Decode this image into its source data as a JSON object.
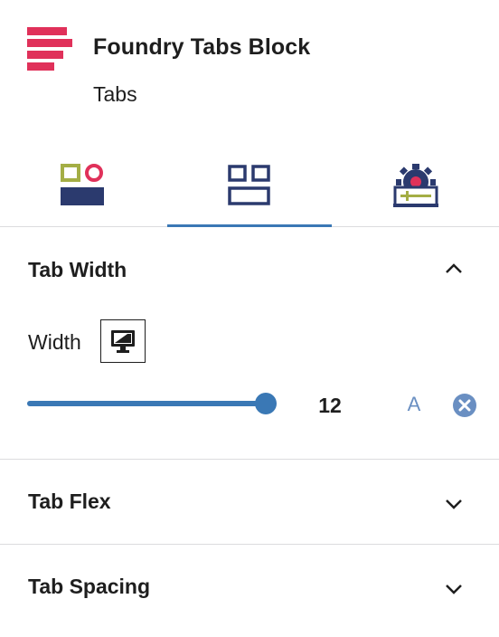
{
  "block": {
    "title": "Foundry Tabs Block",
    "description": "Tabs",
    "logo_color": "#e0315a"
  },
  "inspector_tabs": [
    {
      "name": "style",
      "icon": "style-shapes-icon",
      "active": false
    },
    {
      "name": "layout",
      "icon": "layout-grid-icon",
      "active": true
    },
    {
      "name": "advanced",
      "icon": "settings-gear-icon",
      "active": false
    }
  ],
  "panels": {
    "tab_width": {
      "title": "Tab Width",
      "expanded": true,
      "width_label": "Width",
      "device_icon": "desktop-icon",
      "value": "12",
      "slider_fraction": 1.0,
      "auto_label": "A",
      "reset_icon": "clear-icon"
    },
    "tab_flex": {
      "title": "Tab Flex",
      "expanded": false
    },
    "tab_spacing": {
      "title": "Tab Spacing",
      "expanded": false
    }
  },
  "colors": {
    "accent": "#3a78b5",
    "brand_pink": "#e0315a",
    "navy": "#2b3a6e",
    "olive": "#a4ae45"
  }
}
